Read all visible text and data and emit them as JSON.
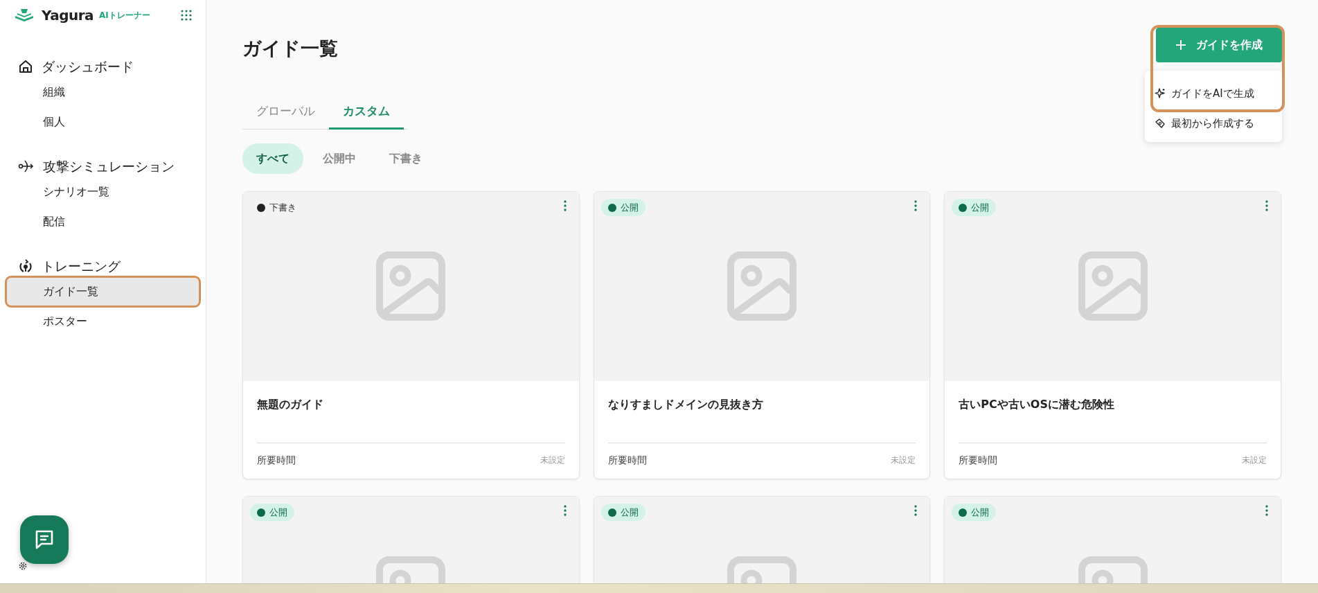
{
  "sidebar": {
    "logo": {
      "name": "Yagura",
      "product": "AIトレーナー"
    },
    "sections": [
      {
        "label": "ダッシュボード",
        "items": [
          {
            "label": "組織",
            "selected": false,
            "highlighted": false
          },
          {
            "label": "個人",
            "selected": false,
            "highlighted": false
          }
        ]
      },
      {
        "label": "攻撃シミュレーション",
        "items": [
          {
            "label": "シナリオ一覧",
            "selected": false,
            "highlighted": false
          },
          {
            "label": "配信",
            "selected": false,
            "highlighted": false
          }
        ]
      },
      {
        "label": "トレーニング",
        "items": [
          {
            "label": "ガイド一覧",
            "selected": true,
            "highlighted": true
          },
          {
            "label": "ポスター",
            "selected": false,
            "highlighted": false
          }
        ]
      }
    ]
  },
  "page": {
    "title": "ガイド一覧"
  },
  "create": {
    "label": "ガイドを作成",
    "highlighted": true,
    "menu": [
      {
        "label": "ガイドをAIで生成"
      },
      {
        "label": "最初から作成する"
      }
    ]
  },
  "tabs": [
    {
      "label": "グローバル",
      "selected": false
    },
    {
      "label": "カスタム",
      "selected": true
    }
  ],
  "filters": [
    {
      "label": "すべて",
      "selected": true
    },
    {
      "label": "公開中",
      "selected": false
    },
    {
      "label": "下書き",
      "selected": false
    }
  ],
  "cards": [
    {
      "kind": "draft",
      "status_label": "下書き",
      "title": "無題のガイド",
      "duration_label": "所要時間",
      "duration": "未設定"
    },
    {
      "kind": "published",
      "status_label": "公開",
      "title": "なりすましドメインの見抜き方",
      "duration_label": "所要時間",
      "duration": "未設定"
    },
    {
      "kind": "published",
      "status_label": "公開",
      "title": "古いPCや古いOSに潜む危険性",
      "duration_label": "所要時間",
      "duration": "未設定"
    },
    {
      "kind": "published",
      "status_label": "公開"
    },
    {
      "kind": "published",
      "status_label": "公開"
    },
    {
      "kind": "published",
      "status_label": "公開"
    }
  ]
}
